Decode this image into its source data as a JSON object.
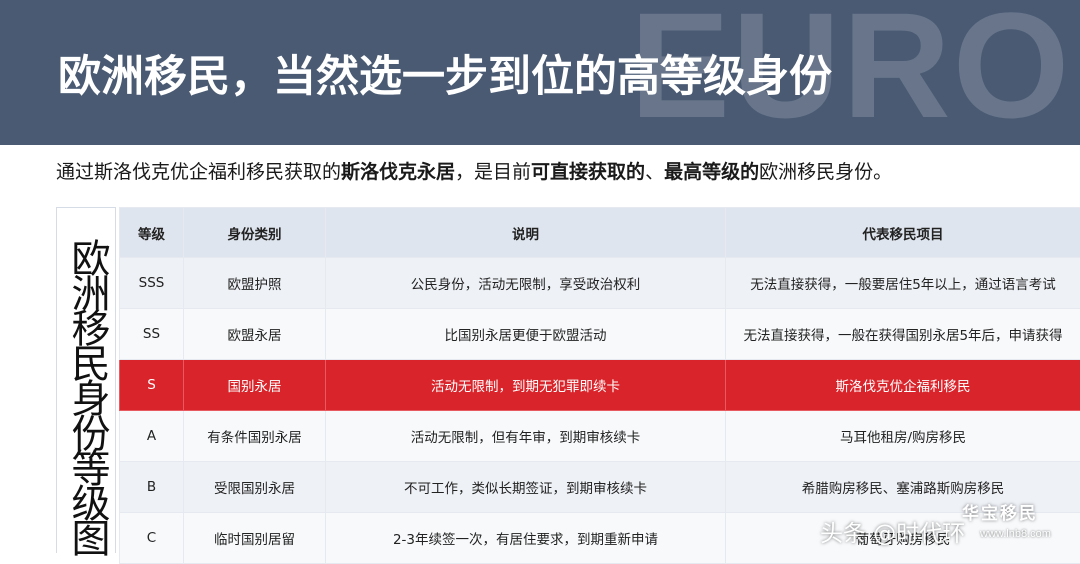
{
  "header": {
    "watermark": "EUROPE",
    "title": "欧洲移民，当然选一步到位的高等级身份"
  },
  "subtitle": {
    "part1": "通过斯洛伐克优企福利移民获取的",
    "bold1": "斯洛伐克永居",
    "part2": "，是目前",
    "bold2": "可直接获取的",
    "part3": "、",
    "bold3": "最高等级的",
    "part4": "欧洲移民身份。"
  },
  "side_label": "欧洲移民身份等级图",
  "table": {
    "headers": [
      "等级",
      "身份类别",
      "说明",
      "代表移民项目"
    ],
    "rows": [
      [
        "SSS",
        "欧盟护照",
        "公民身份，活动无限制，享受政治权利",
        "无法直接获得，一般要居住5年以上，通过语言考试"
      ],
      [
        "SS",
        "欧盟永居",
        "比国别永居更便于欧盟活动",
        "无法直接获得，一般在获得国别永居5年后，申请获得"
      ],
      [
        "S",
        "国别永居",
        "活动无限制，到期无犯罪即续卡",
        "斯洛伐克优企福利移民"
      ],
      [
        "A",
        "有条件国别永居",
        "活动无限制，但有年审，到期审核续卡",
        "马耳他租房/购房移民"
      ],
      [
        "B",
        "受限国别永居",
        "不可工作，类似长期签证，到期审核续卡",
        "希腊购房移民、塞浦路斯购房移民"
      ],
      [
        "C",
        "临时国别居留",
        "2-3年续签一次，有居住要求，到期重新申请",
        "葡萄牙购房移民"
      ]
    ],
    "highlight_row": 2
  },
  "watermarks": {
    "toutiao": "头条 @时代环",
    "brand": "华宝移民",
    "url": "www.lnb8.com"
  },
  "colors": {
    "header_bg": "#4a5a73",
    "highlight_row": "#d9242b",
    "table_header_bg": "#dfe5ee"
  }
}
